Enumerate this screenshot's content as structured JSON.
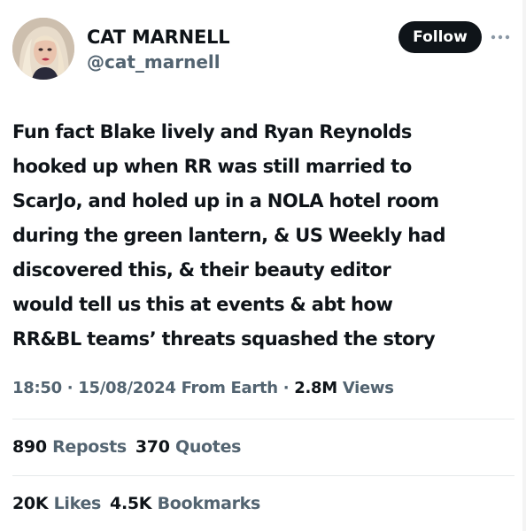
{
  "author": {
    "display_name": "CAT MARNELL",
    "handle": "@cat_marnell"
  },
  "follow_label": "Follow",
  "tweet": {
    "lines": [
      "Fun fact Blake lively and Ryan Reynolds",
      "hooked up when RR was still married to",
      "ScarJo, and holed up in a NOLA hotel room",
      "during the green lantern, & US Weekly had",
      "discovered this, & their beauty editor",
      "would tell us this at events & abt how",
      "RR&BL teams’ threats squashed the story"
    ]
  },
  "meta": {
    "time": "18:50",
    "date": "15/08/2024",
    "source": "From Earth",
    "views_count": "2.8M",
    "views_label": "Views",
    "separator": "·"
  },
  "stats": {
    "reposts_count": "890",
    "reposts_label": "Reposts",
    "quotes_count": "370",
    "quotes_label": "Quotes",
    "likes_count": "20K",
    "likes_label": "Likes",
    "bookmarks_count": "4.5K",
    "bookmarks_label": "Bookmarks"
  },
  "icons": {
    "more": "more-dots-icon"
  },
  "colors": {
    "text_primary": "#0f1419",
    "text_secondary": "#536471",
    "follow_bg": "#0f1419",
    "divider": "#e6e9eb"
  }
}
